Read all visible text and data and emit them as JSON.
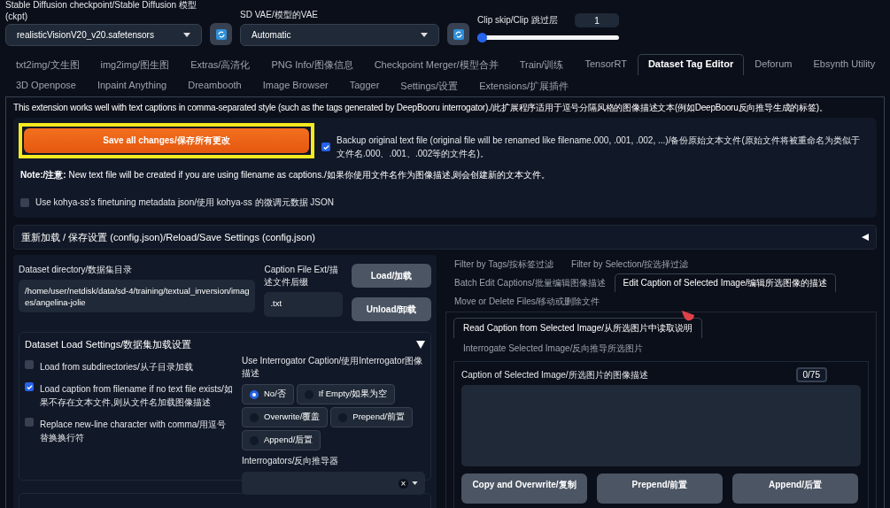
{
  "top": {
    "checkpoint": {
      "label": "Stable Diffusion checkpoint/Stable Diffusion 模型(ckpt)",
      "value": "realisticVisionV20_v20.safetensors"
    },
    "vae": {
      "label": "SD VAE/模型的VAE",
      "value": "Automatic"
    },
    "clip_skip": {
      "label": "Clip skip/Clip 跳过层",
      "value": "1",
      "level": 0
    }
  },
  "tab_rows": [
    [
      {
        "label": "txt2img/文生图",
        "selected": false
      },
      {
        "label": "img2img/图生图",
        "selected": false
      },
      {
        "label": "Extras/高清化",
        "selected": false
      },
      {
        "label": "PNG Info/图像信息",
        "selected": false
      },
      {
        "label": "Checkpoint Merger/模型合并",
        "selected": false
      },
      {
        "label": "Train/训练",
        "selected": false
      },
      {
        "label": "TensorRT",
        "selected": false
      },
      {
        "label": "Dataset Tag Editor",
        "selected": true
      },
      {
        "label": "Deforum",
        "selected": false
      },
      {
        "label": "Ebsynth Utility",
        "selected": false
      }
    ],
    [
      {
        "label": "3D Openpose",
        "selected": false
      },
      {
        "label": "Inpaint Anything",
        "selected": false
      },
      {
        "label": "Dreambooth",
        "selected": false
      },
      {
        "label": "Image Browser",
        "selected": false
      },
      {
        "label": "Tagger",
        "selected": false
      },
      {
        "label": "Settings/设置",
        "selected": false
      },
      {
        "label": "Extensions/扩展插件",
        "selected": false
      }
    ]
  ],
  "notice": "This extension works well with text captions in comma-separated style (such as the tags generated by DeepBooru interrogator)./此扩展程序适用于逗号分隔风格的图像描述文本(例如DeepBooru反向推导生成的标签)。",
  "save_button": "Save all changes/保存所有更改",
  "backup": {
    "label": "Backup original text file (original file will be renamed like filename.000, .001, .002, ...)/备份原始文本文件(原始文件将被重命名为类似于文件名.000、.001、.002等的文件名)。",
    "checked": true
  },
  "note": "**Note:/注意:**  New text file will be created if you are using filename as captions./如果你使用文件名作为图像描述,则会创建新的文本文件。",
  "kohya": {
    "label": "Use kohya-ss's finetuning metadata json/使用 kohya-ss 的微调元数据 JSON",
    "checked": false
  },
  "reload_section": {
    "title": "重新加载 / 保存设置 (config.json)/Reload/Save Settings (config.json)",
    "expanded": false
  },
  "dataset": {
    "directory_label": "Dataset directory/数据集目录",
    "directory_value": "/home/user/netdisk/data/sd-4/training/textual_inversion/images/angelina-jolie",
    "ext_label": "Caption File Ext/描述文件后缀",
    "ext_value": ".txt",
    "load_button": "Load/加载",
    "unload_button": "Unload/卸载"
  },
  "load_settings": {
    "title": "Dataset Load Settings/数据集加载设置",
    "expanded": true,
    "checkboxes": [
      {
        "label": "Load from subdirectories/从子目录加载",
        "checked": false
      },
      {
        "label": "Load caption from filename if no text file exists/如果不存在文本文件,则从文件名加载图像描述",
        "checked": true
      },
      {
        "label": "Replace new-line character with comma/用逗号替换换行符",
        "checked": false
      }
    ],
    "interrogator_caption": {
      "label": "Use Interrogator Caption/使用Interrogator图像描述",
      "options": [
        {
          "label": "No/否",
          "selected": true
        },
        {
          "label": "If Empty/如果为空",
          "selected": false
        },
        {
          "label": "Overwrite/覆盖",
          "selected": false
        },
        {
          "label": "Prepend/前置",
          "selected": false
        },
        {
          "label": "Append/后置",
          "selected": false
        }
      ]
    },
    "interrogators": {
      "label": "Interrogators/反向推导器",
      "clear": "×"
    }
  },
  "right_tabs": [
    {
      "label": "Filter by Tags/按标签过滤",
      "selected": false
    },
    {
      "label": "Filter by Selection/按选择过滤",
      "selected": false
    },
    {
      "label": "Batch Edit Captions/批量编辑图像描述",
      "selected": false
    },
    {
      "label": "Edit Caption of Selected Image/编辑所选图像的描述",
      "selected": true
    },
    {
      "label": "Move or Delete Files/移动或删除文件",
      "selected": false
    }
  ],
  "sub_tabs": [
    {
      "label": "Read Caption from Selected Image/从所选图片中读取说明",
      "selected": true
    },
    {
      "label": "Interrogate Selected Image/反向推导所选图片",
      "selected": false
    }
  ],
  "caption": {
    "label": "Caption of Selected Image/所选图片的图像描述",
    "counter": "0/75"
  },
  "buttons": [
    "Copy and Overwrite/复制",
    "Prepend/前置",
    "Append/后置"
  ]
}
